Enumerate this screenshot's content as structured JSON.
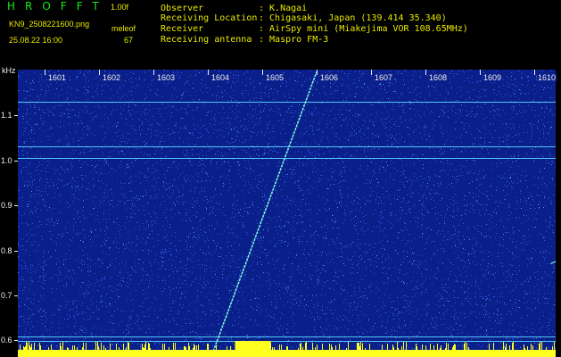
{
  "header": {
    "title": "HROFFT",
    "version": "1.00f",
    "filename": "KN9_2508221600.png",
    "mode": "meleof",
    "datetime": "25.08.22 16:00",
    "count": "67"
  },
  "meta": [
    {
      "label": "Observer",
      "value": ": K.Nagai"
    },
    {
      "label": "Receiving Location",
      "value": ": Chigasaki, Japan (139.414 35.340)"
    },
    {
      "label": "Receiver",
      "value": ": AirSpy mini (Miakejima VOR 108.65MHz)"
    },
    {
      "label": "Receiving antenna",
      "value": ": Maspro FM-3"
    }
  ],
  "spectrogram": {
    "unit": "kHz",
    "time_labels": [
      "1601",
      "1602",
      "1603",
      "1604",
      "1605",
      "1606",
      "1607",
      "1608",
      "1609",
      "1610"
    ],
    "freq_labels": [
      "1.1",
      "1.0",
      "0.9",
      "0.8",
      "0.7",
      "0.6"
    ],
    "freq_values": [
      1.1,
      1.0,
      0.9,
      0.8,
      0.7,
      0.6
    ],
    "freq_range_khz": [
      0.573,
      1.18
    ],
    "time_range_min": [
      0,
      10
    ],
    "colors": {
      "background": "#0a1f8a",
      "noise": "#3a66ff",
      "carrier": "#58d8ff",
      "echo": "#80ffe0",
      "bottom_band": "#ffff20"
    },
    "carriers_khz": [
      1.112,
      1.018,
      0.993,
      0.617,
      0.607
    ],
    "meteor_trail": {
      "start_min": 3.1,
      "start_khz": 0.585,
      "end_min": 5.0,
      "end_khz": 1.175
    },
    "short_echo": {
      "start_min": 9.3,
      "start_khz": 0.77,
      "end_min": 9.7,
      "end_khz": 0.79
    }
  }
}
